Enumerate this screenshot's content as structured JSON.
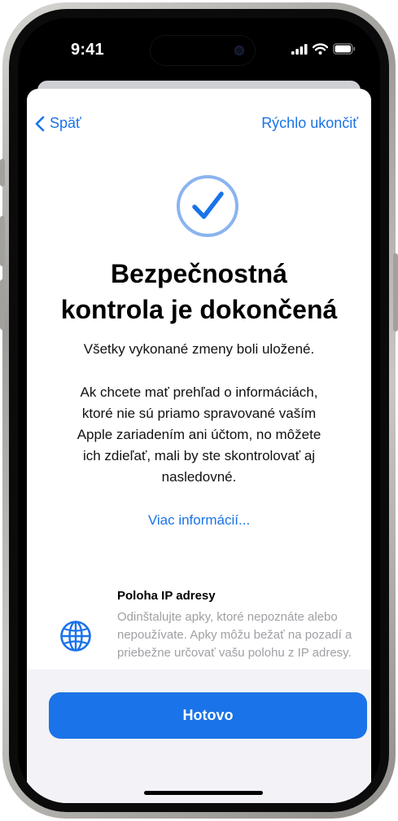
{
  "status_bar": {
    "time": "9:41"
  },
  "nav": {
    "back_label": "Späť",
    "quick_exit_label": "Rýchlo ukončiť"
  },
  "content": {
    "title_line1": "Bezpečnostná",
    "title_line2": "kontrola je dokončená",
    "saved_text": "Všetky vykonané zmeny boli uložené.",
    "body_text": "Ak chcete mať prehľad o informáciách, ktoré nie sú priamo spravované vaším Apple zariadením ani účtom, no môžete ich zdieľať, mali by ste skontrolovať aj nasledovné.",
    "more_link": "Viac informácií..."
  },
  "items": [
    {
      "icon": "globe-icon",
      "title": "Poloha IP adresy",
      "description": "Odinštalujte apky, ktoré nepoznáte alebo nepoužívate. Apky môžu bežať na pozadí a priebežne určovať vašu polohu z IP adresy."
    }
  ],
  "footer": {
    "done_label": "Hotovo"
  },
  "colors": {
    "accent": "#1a73e8",
    "check_ring": "#8ab4f0",
    "secondary_text": "#a0a0a5",
    "panel_bg": "#f2f2f7"
  }
}
